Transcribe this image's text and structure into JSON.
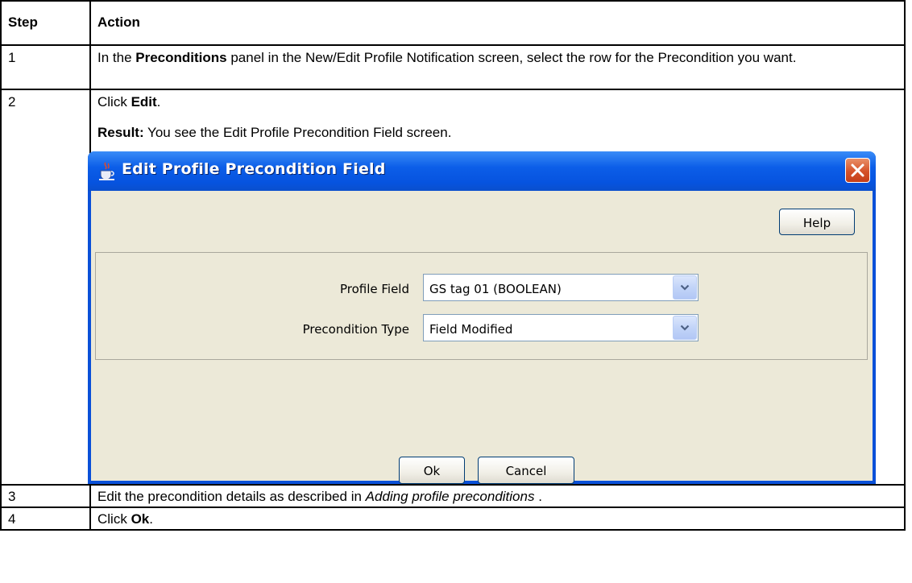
{
  "table": {
    "headers": {
      "step": "Step",
      "action": "Action"
    },
    "rows": [
      {
        "step": "1",
        "pre": "In the ",
        "bold": "Preconditions",
        "post": " panel in the New/Edit Profile Notification screen, select the row for the Precondition you want."
      },
      {
        "step": "2",
        "pre": "Click ",
        "bold": "Edit",
        "post": ".",
        "result_label": "Result:",
        "result_text": " You see the Edit Profile Precondition Field screen."
      },
      {
        "step": "3",
        "pre": "Edit the precondition details as described in ",
        "italic": "Adding profile preconditions",
        "post": " ."
      },
      {
        "step": "4",
        "pre": "Click ",
        "bold": "Ok",
        "post": "."
      }
    ]
  },
  "dialog": {
    "title": "Edit Profile Precondition Field",
    "help_label": "Help",
    "fields": [
      {
        "label": "Profile Field",
        "value": "GS tag 01 (BOOLEAN)"
      },
      {
        "label": "Precondition Type",
        "value": "Field Modified"
      }
    ],
    "ok_label": "Ok",
    "cancel_label": "Cancel",
    "icons": {
      "title": "java-cup-icon",
      "close": "close-icon",
      "dropdown": "chevron-down-icon"
    },
    "colors": {
      "titlebar": "#0653df",
      "client": "#ece9d8",
      "close": "#d5532a"
    }
  }
}
